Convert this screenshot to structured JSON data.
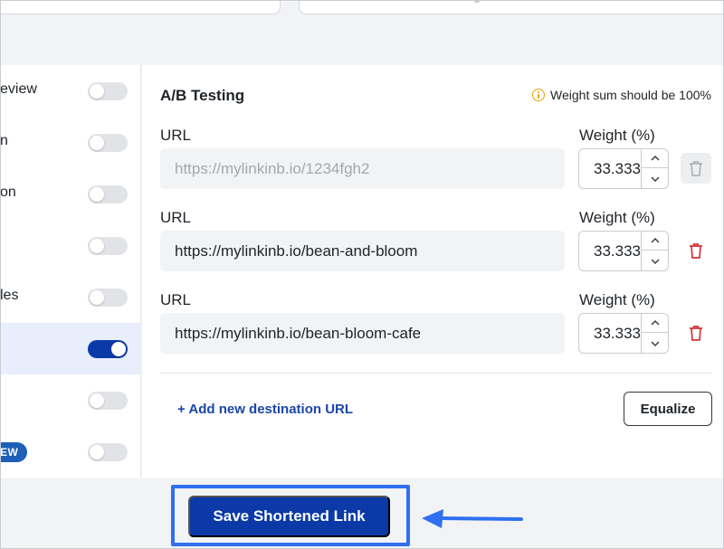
{
  "sidebar": {
    "items": [
      {
        "label": "eview",
        "toggle_on": false
      },
      {
        "label": "n",
        "toggle_on": false
      },
      {
        "label": "on",
        "toggle_on": false
      },
      {
        "label": "",
        "toggle_on": false
      },
      {
        "label": "les",
        "toggle_on": false
      },
      {
        "label": "",
        "toggle_on": true,
        "active": true
      },
      {
        "label": "",
        "toggle_on": false
      },
      {
        "label": "",
        "badge": "EW",
        "toggle_on": false
      }
    ]
  },
  "ab_testing": {
    "title": "A/B Testing",
    "warning": "Weight sum should be 100%",
    "url_label": "URL",
    "weight_label": "Weight (%)",
    "destinations": [
      {
        "url": "https://mylinkinb.io/1234fgh2",
        "weight": "33.333",
        "disabled": true
      },
      {
        "url": "https://mylinkinb.io/bean-and-bloom",
        "weight": "33.333",
        "disabled": false
      },
      {
        "url": "https://mylinkinb.io/bean-bloom-cafe",
        "weight": "33.333",
        "disabled": false
      }
    ],
    "add_label": "+ Add new destination URL",
    "equalize_label": "Equalize"
  },
  "footer": {
    "save_label": "Save Shortened Link"
  },
  "colors": {
    "primary": "#0b3aa8",
    "highlight": "#2f6ff0",
    "delete": "#d13438",
    "warning": "#e3a408",
    "link": "#1a47a6"
  },
  "icons": {
    "warning": "info-circle-icon",
    "delete": "trash-icon",
    "stepper_up": "chevron-up-icon",
    "stepper_down": "chevron-down-icon",
    "annotation": "arrow-left-icon"
  }
}
